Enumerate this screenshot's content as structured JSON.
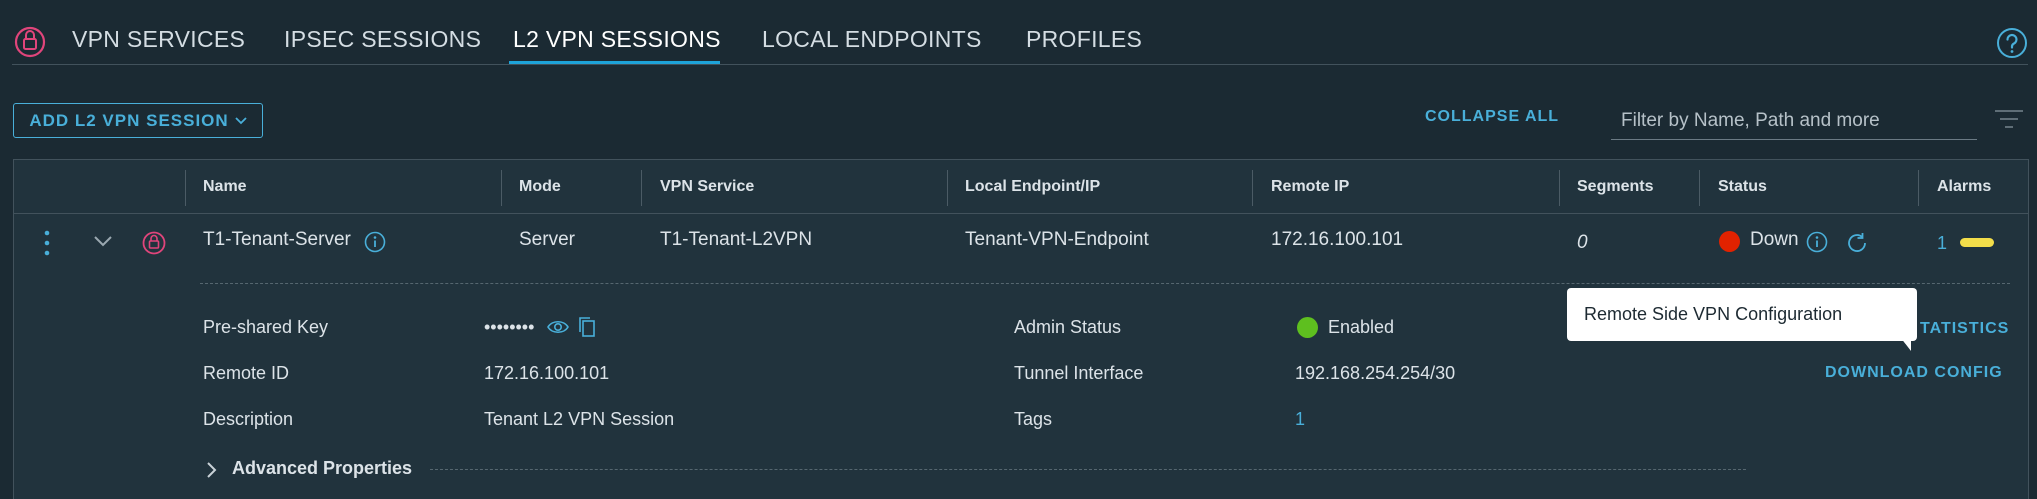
{
  "tabs": [
    {
      "label": "VPN SERVICES"
    },
    {
      "label": "IPSEC SESSIONS"
    },
    {
      "label": "L2 VPN SESSIONS"
    },
    {
      "label": "LOCAL ENDPOINTS"
    },
    {
      "label": "PROFILES"
    }
  ],
  "active_tab": "L2 VPN SESSIONS",
  "toolbar": {
    "add_button_label": "ADD L2 VPN SESSION",
    "collapse_all_label": "COLLAPSE ALL",
    "filter_placeholder": "Filter by Name, Path and more"
  },
  "table": {
    "columns": [
      "Name",
      "Mode",
      "VPN Service",
      "Local Endpoint/IP",
      "Remote IP",
      "Segments",
      "Status",
      "Alarms"
    ],
    "row": {
      "name": "T1-Tenant-Server",
      "mode": "Server",
      "vpn_service": "T1-Tenant-L2VPN",
      "local_endpoint": "Tenant-VPN-Endpoint",
      "remote_ip": "172.16.100.101",
      "segments": "0",
      "status": "Down",
      "alarms": "1"
    }
  },
  "details": {
    "pre_shared_key_label": "Pre-shared Key",
    "pre_shared_key_value": "••••••••",
    "remote_id_label": "Remote ID",
    "remote_id_value": "172.16.100.101",
    "description_label": "Description",
    "description_value": "Tenant L2 VPN Session",
    "admin_status_label": "Admin Status",
    "admin_status_value": "Enabled",
    "tunnel_interface_label": "Tunnel Interface",
    "tunnel_interface_value": "192.168.254.254/30",
    "tags_label": "Tags",
    "tags_value": "1",
    "statistics_partial": "TATISTICS",
    "download_config_label": "DOWNLOAD CONFIG",
    "advanced_properties_label": "Advanced Properties"
  },
  "tooltip": {
    "text": "Remote Side VPN Configuration"
  },
  "colors": {
    "background": "#1b2a33",
    "accent": "#49afd9",
    "status_down": "#e12200",
    "status_enabled": "#5ebf1f",
    "alarm_warning": "#f3de4a",
    "vpn_icon": "#e0457b"
  },
  "icons": [
    "lock-icon",
    "help-icon",
    "chevron-down-icon",
    "filter-icon",
    "more-vertical-icon",
    "vpn-lock-icon",
    "info-icon",
    "refresh-icon",
    "eye-icon",
    "copy-icon",
    "chevron-right-icon"
  ]
}
